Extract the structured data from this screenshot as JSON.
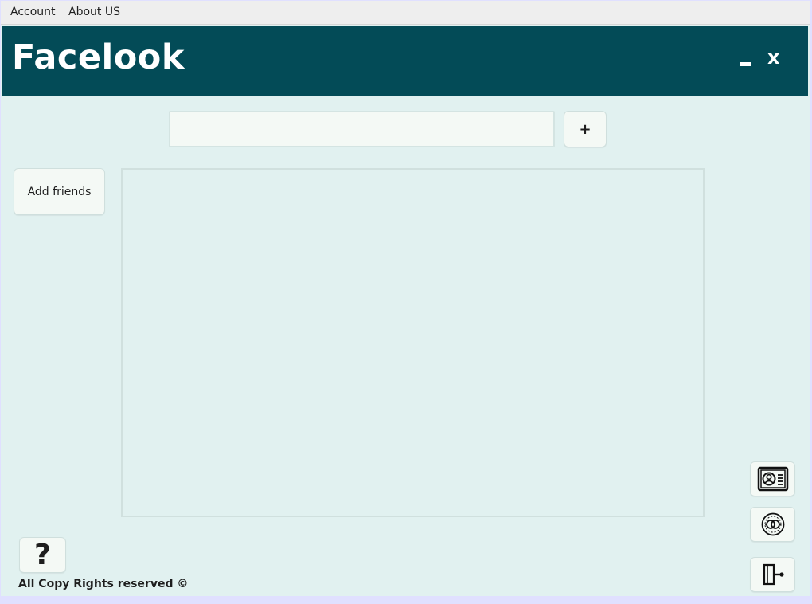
{
  "menubar": {
    "items": [
      "Account",
      "About US"
    ]
  },
  "header": {
    "title": "Facelook",
    "minimize_label": "",
    "close_label": "x"
  },
  "search": {
    "value": "",
    "placeholder": "",
    "add_label": "+"
  },
  "sidebar": {
    "add_friends_label": "Add friends"
  },
  "help": {
    "label": "?"
  },
  "footer": {
    "text": "All Copy Rights reserved ©"
  },
  "side_buttons": {
    "icons": [
      "profile-card-icon",
      "settings-dial-icon",
      "logout-icon"
    ]
  },
  "colors": {
    "header_bg": "#034b57",
    "window_bg": "#e1f1f0",
    "button_bg": "#f4f9f5",
    "menubar_bg": "#eeeeee"
  }
}
